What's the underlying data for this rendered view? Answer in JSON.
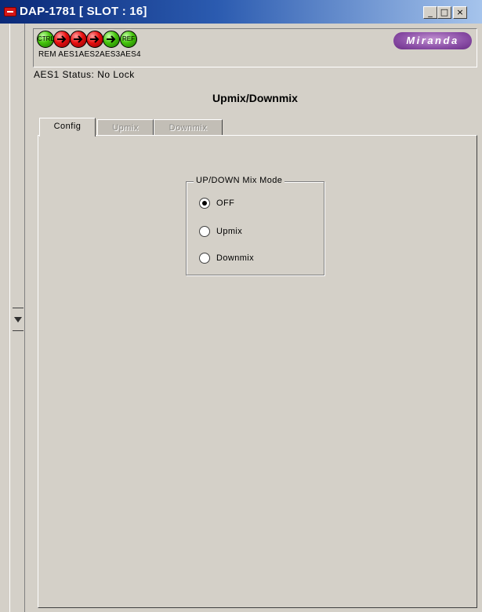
{
  "window": {
    "title": "DAP-1781 [ SLOT : 16]",
    "min_glyph": "_",
    "max_glyph": "□",
    "close_glyph": "×"
  },
  "indicators": [
    {
      "name": "CTRL",
      "color": "green",
      "icon": "text"
    },
    {
      "name": "AES1",
      "color": "red",
      "icon": "arrow-right-icon"
    },
    {
      "name": "AES2",
      "color": "red",
      "icon": "arrow-right-icon"
    },
    {
      "name": "AES3",
      "color": "red",
      "icon": "arrow-right-icon"
    },
    {
      "name": "AES4",
      "color": "green",
      "icon": "arrow-right-icon"
    },
    {
      "name": "REF",
      "color": "green",
      "icon": "text"
    }
  ],
  "indicator_labels": "REM AES1AES2AES3AES4",
  "logo": "Miranda",
  "status_line": "AES1 Status: No Lock",
  "page_title": "Upmix/Downmix",
  "tabs": [
    {
      "label": "Config",
      "state": "active"
    },
    {
      "label": "Upmix",
      "state": "disabled"
    },
    {
      "label": "Downmix",
      "state": "disabled"
    }
  ],
  "mix_mode": {
    "legend": "UP/DOWN Mix Mode",
    "options": [
      "OFF",
      "Upmix",
      "Downmix"
    ],
    "selected": "OFF"
  },
  "colors": {
    "active_green": "#45c40b",
    "alarm_red": "#e81010",
    "logo_purple": "#8a4ea6",
    "titlebar_blue": "#0b2a78"
  }
}
